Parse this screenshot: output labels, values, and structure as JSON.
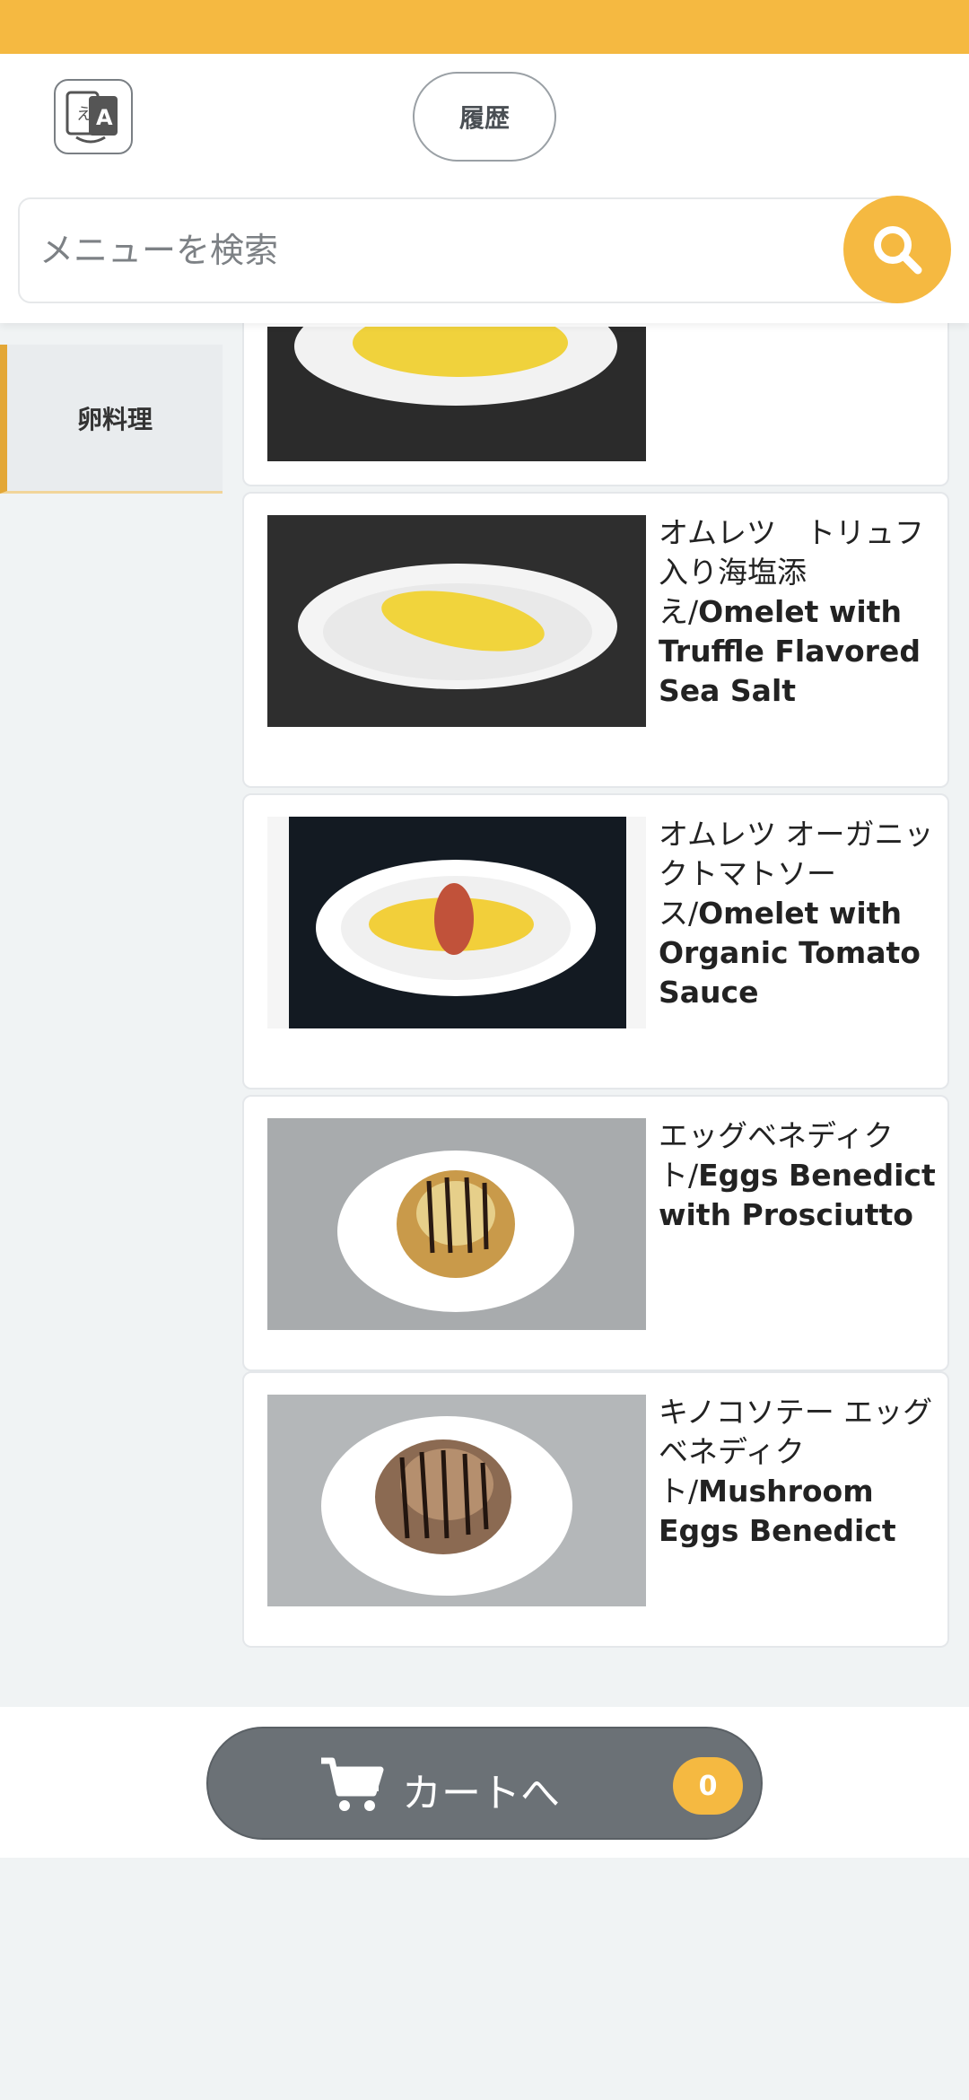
{
  "header": {
    "history_label": "履歴",
    "search_placeholder": "メニューを検索"
  },
  "sidebar": {
    "items": [
      {
        "label": "卵料理",
        "selected": true
      }
    ]
  },
  "menu": {
    "items": [
      {
        "name_jp": "",
        "name_en": ""
      },
      {
        "name_jp": "オムレツ　トリュフ入り海塩添え/",
        "name_en": "Omelet with Truffle Flavored Sea Salt"
      },
      {
        "name_jp": "オムレツ オーガニックトマトソース/",
        "name_en": "Omelet with Organic Tomato Sauce"
      },
      {
        "name_jp": "エッグベネディクト/",
        "name_en": "Eggs Benedict with Prosciutto"
      },
      {
        "name_jp": "キノコソテー エッグベネディクト/",
        "name_en": "Mushroom Eggs Benedict"
      }
    ]
  },
  "cart": {
    "label": "カートへ",
    "count": "0"
  },
  "colors": {
    "accent": "#f5b941",
    "cart_button": "#6b7176",
    "background": "#f0f3f4"
  },
  "icons": [
    "translate-icon",
    "search-icon",
    "cart-icon"
  ]
}
